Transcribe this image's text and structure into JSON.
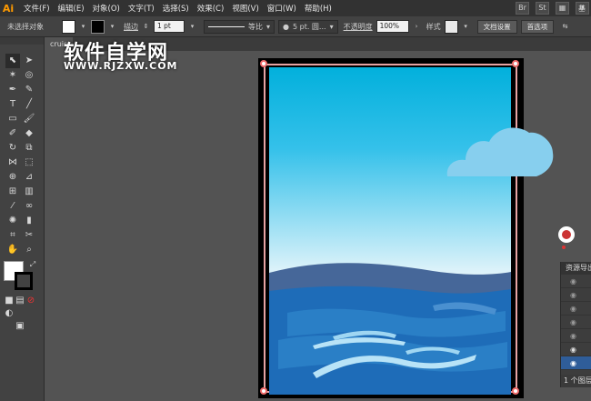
{
  "app": {
    "logo": "Ai"
  },
  "menu": [
    "文件(F)",
    "编辑(E)",
    "对象(O)",
    "文字(T)",
    "选择(S)",
    "效果(C)",
    "视图(V)",
    "窗口(W)",
    "帮助(H)"
  ],
  "menu_right": {
    "br_icon": "Br",
    "st_icon": "St",
    "layout_icon": "layout-icon",
    "rocket_icon": "rocket-icon",
    "workspace": "基"
  },
  "control": {
    "no_selection": "未选择对象",
    "stroke_label": "描边",
    "stroke_weight": "1 pt",
    "stroke_profile": "等比",
    "brush": "5 pt. 圆...",
    "opacity_label": "不透明度",
    "opacity_value": "100%",
    "style_label": "样式",
    "doc_setup_button": "文档设置",
    "prefs_button": "首选项"
  },
  "document_tab": "cruis",
  "watermark": {
    "title": "软件自学网",
    "url": "WWW.RJZXW.COM"
  },
  "layers_panel": {
    "title": "资源导出",
    "rows": 8,
    "footer": "1 个图层"
  },
  "colors": {
    "sky_top": "#02b0dc",
    "sky_bottom": "#ffffff",
    "sea_back": "#466799",
    "sea_front": "#1e6cb8",
    "wave_dark": "#2a8ad0",
    "wave_light": "#9fd6f2",
    "cloud": "#87cfee",
    "frame": "#000000",
    "frame_line": "#e7a3a3"
  }
}
